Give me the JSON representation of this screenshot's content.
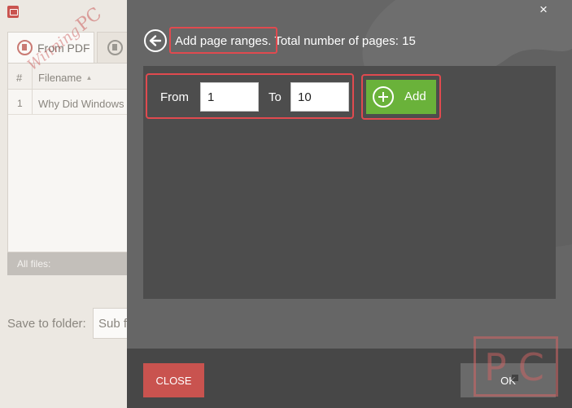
{
  "app": {
    "tabs": [
      {
        "label": "From PDF",
        "icon": "pdf-export-icon"
      },
      {
        "label": "",
        "icon": "convert-icon"
      }
    ],
    "table": {
      "col_number": "#",
      "col_filename": "Filename",
      "rows": [
        {
          "num": "1",
          "name": "Why Did Windows"
        }
      ]
    },
    "footer_label": "All files:",
    "save_label": "Save to folder:",
    "save_value": "Sub f"
  },
  "dialog": {
    "title_part1": "Add page ranges.",
    "title_part2": "Total number of pages: 15",
    "from_label": "From",
    "from_value": "1",
    "to_label": "To",
    "to_value": "10",
    "add_label": "Add",
    "close_label": "CLOSE",
    "ok_label": "OK",
    "close_icon": "×"
  },
  "watermark": {
    "script_text": "Winning",
    "big_text": "PC",
    "box_text": "PC"
  },
  "colors": {
    "accent_red": "#e04a4f",
    "add_green": "#6ab23a",
    "close_red": "#c9534f",
    "modal_gray": "#666666",
    "panel_gray": "#4d4d4d"
  }
}
